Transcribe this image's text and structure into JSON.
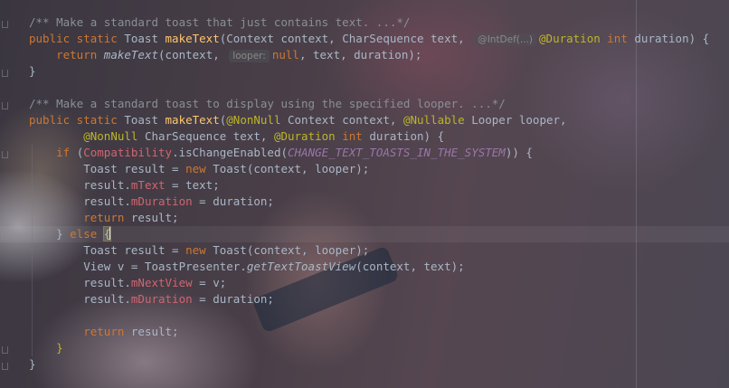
{
  "editor": {
    "lines": [
      {
        "segs": [
          [
            "cm",
            "/** Make a standard toast that just contains text. ...*/"
          ]
        ]
      },
      {
        "segs": [
          [
            "kw",
            "public static "
          ],
          [
            "t",
            "Toast "
          ],
          [
            "fn",
            "makeText"
          ],
          [
            "t",
            "(Context context, CharSequence text, "
          ],
          [
            "hint",
            "@IntDef(...)"
          ],
          [
            "ann",
            "@Duration "
          ],
          [
            "kw",
            "int "
          ],
          [
            "t",
            "duration) {"
          ]
        ]
      },
      {
        "segs": [
          [
            "t",
            "    "
          ],
          [
            "kw",
            "return "
          ],
          [
            "it",
            "makeText"
          ],
          [
            "t",
            "(context, "
          ],
          [
            "hint",
            "looper:"
          ],
          [
            "kw",
            "null"
          ],
          [
            "t",
            ", text, duration);"
          ]
        ]
      },
      {
        "segs": [
          [
            "t",
            "}"
          ]
        ]
      },
      {
        "segs": []
      },
      {
        "segs": [
          [
            "cm",
            "/** Make a standard toast to display using the specified looper. ...*/"
          ]
        ]
      },
      {
        "segs": [
          [
            "kw",
            "public static "
          ],
          [
            "t",
            "Toast "
          ],
          [
            "fn",
            "makeText"
          ],
          [
            "t",
            "("
          ],
          [
            "ann",
            "@NonNull "
          ],
          [
            "t",
            "Context context, "
          ],
          [
            "ann",
            "@Nullable "
          ],
          [
            "t",
            "Looper looper,"
          ]
        ]
      },
      {
        "segs": [
          [
            "t",
            "        "
          ],
          [
            "ann",
            "@NonNull "
          ],
          [
            "t",
            "CharSequence text, "
          ],
          [
            "ann",
            "@Duration "
          ],
          [
            "kw",
            "int "
          ],
          [
            "t",
            "duration) {"
          ]
        ]
      },
      {
        "segs": [
          [
            "t",
            "    "
          ],
          [
            "kw",
            "if "
          ],
          [
            "t",
            "("
          ],
          [
            "field",
            "Compatibility"
          ],
          [
            "t",
            ".isChangeEnabled("
          ],
          [
            "const",
            "CHANGE_TEXT_TOASTS_IN_THE_SYSTEM"
          ],
          [
            "t",
            ")) {"
          ]
        ]
      },
      {
        "segs": [
          [
            "t",
            "        Toast result = "
          ],
          [
            "kw",
            "new "
          ],
          [
            "t",
            "Toast(context, looper);"
          ]
        ]
      },
      {
        "segs": [
          [
            "t",
            "        result."
          ],
          [
            "field",
            "mText"
          ],
          [
            "t",
            " = text;"
          ]
        ]
      },
      {
        "segs": [
          [
            "t",
            "        result."
          ],
          [
            "field",
            "mDuration"
          ],
          [
            "t",
            " = duration;"
          ]
        ]
      },
      {
        "segs": [
          [
            "t",
            "        "
          ],
          [
            "kw",
            "return "
          ],
          [
            "t",
            "result;"
          ]
        ]
      },
      {
        "segs": [
          [
            "t",
            "    } "
          ],
          [
            "kw",
            "else "
          ],
          [
            "bracket",
            "{"
          ],
          [
            "caret",
            ""
          ]
        ]
      },
      {
        "segs": [
          [
            "t",
            "        Toast result = "
          ],
          [
            "kw",
            "new "
          ],
          [
            "t",
            "Toast(context, looper);"
          ]
        ]
      },
      {
        "segs": [
          [
            "t",
            "        View v = ToastPresenter."
          ],
          [
            "it",
            "getTextToastView"
          ],
          [
            "t",
            "(context, text);"
          ]
        ]
      },
      {
        "segs": [
          [
            "t",
            "        result."
          ],
          [
            "field",
            "mNextView"
          ],
          [
            "t",
            " = v;"
          ]
        ]
      },
      {
        "segs": [
          [
            "t",
            "        result."
          ],
          [
            "field",
            "mDuration"
          ],
          [
            "t",
            " = duration;"
          ]
        ]
      },
      {
        "segs": []
      },
      {
        "segs": [
          [
            "t",
            "        "
          ],
          [
            "kw",
            "return "
          ],
          [
            "t",
            "result;"
          ]
        ]
      },
      {
        "segs": [
          [
            "t",
            "    "
          ],
          [
            "ann",
            "}"
          ]
        ]
      },
      {
        "segs": [
          [
            "t",
            "}"
          ]
        ]
      }
    ]
  },
  "colors": {
    "keyword": "#cc7832",
    "method": "#ffc66d",
    "field": "#d06570",
    "annotation": "#bbb529",
    "comment": "#8a8f96",
    "constant": "#9876aa",
    "text": "#a9b7c6"
  }
}
